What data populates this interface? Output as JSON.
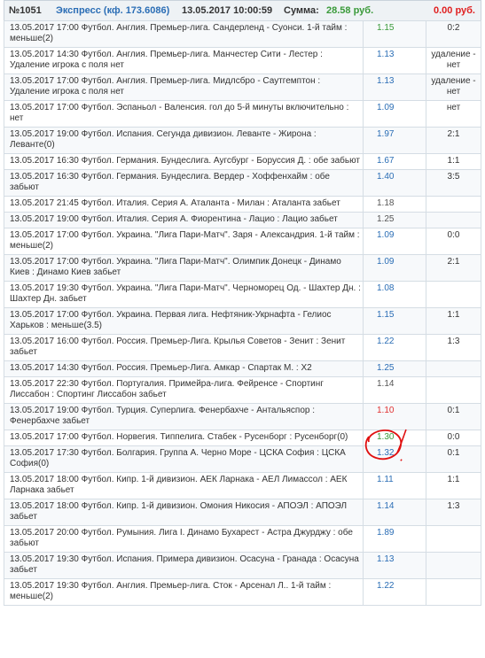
{
  "header": {
    "number": "№1051",
    "express": "Экспресс (кф. 173.6086)",
    "datetime": "13.05.2017 10:00:59",
    "sum_label": "Сумма:",
    "sum_value": "28.58 руб.",
    "win": "0.00 руб."
  },
  "rows": [
    {
      "event": "13.05.2017 17:00 Футбол. Англия. Премьер-лига. Сандерленд - Суонси. 1-й тайм : меньше(2)",
      "coef": "1.15",
      "coef_color": "green",
      "result": "0:2"
    },
    {
      "event": "13.05.2017 14:30 Футбол. Англия. Премьер-лига. Манчестер Сити - Лестер : Удаление игрока с поля нет",
      "coef": "1.13",
      "coef_color": "blue",
      "result": "удаление - нет"
    },
    {
      "event": "13.05.2017 17:00 Футбол. Англия. Премьер-лига. Мидлсбро - Саутгемптон : Удаление игрока с поля нет",
      "coef": "1.13",
      "coef_color": "blue",
      "result": "удаление - нет"
    },
    {
      "event": "13.05.2017 17:00 Футбол. Эспаньол - Валенсия. гол до 5-й минуты включительно : нет",
      "coef": "1.09",
      "coef_color": "blue",
      "result": "нет"
    },
    {
      "event": "13.05.2017 19:00 Футбол. Испания. Сегунда дивизион. Леванте - Жирона : Леванте(0)",
      "coef": "1.97",
      "coef_color": "blue",
      "result": "2:1"
    },
    {
      "event": "13.05.2017 16:30 Футбол. Германия. Бундеслига. Аугсбург - Боруссия Д. : обе забьют",
      "coef": "1.67",
      "coef_color": "blue",
      "result": "1:1"
    },
    {
      "event": "13.05.2017 16:30 Футбол. Германия. Бундеслига. Вердер - Хоффенхайм : обе забьют",
      "coef": "1.40",
      "coef_color": "blue",
      "result": "3:5"
    },
    {
      "event": "13.05.2017 21:45 Футбол. Италия. Серия А. Аталанта - Милан : Аталанта забьет",
      "coef": "1.18",
      "coef_color": "gray",
      "result": ""
    },
    {
      "event": "13.05.2017 19:00 Футбол. Италия. Серия А. Фиорентина - Лацио : Лацио забьет",
      "coef": "1.25",
      "coef_color": "gray",
      "result": ""
    },
    {
      "event": "13.05.2017 17:00 Футбол. Украина. \"Лига Пари-Матч\". Заря - Александрия. 1-й тайм : меньше(2)",
      "coef": "1.09",
      "coef_color": "blue",
      "result": "0:0"
    },
    {
      "event": "13.05.2017 17:00 Футбол. Украина. \"Лига Пари-Матч\". Олимпик Донецк - Динамо Киев : Динамо Киев забьет",
      "coef": "1.09",
      "coef_color": "blue",
      "result": "2:1"
    },
    {
      "event": "13.05.2017 19:30 Футбол. Украина. \"Лига Пари-Матч\". Черноморец Од. - Шахтер Дн. : Шахтер Дн. забьет",
      "coef": "1.08",
      "coef_color": "blue",
      "result": ""
    },
    {
      "event": "13.05.2017 17:00 Футбол. Украина. Первая лига. Нефтяник-Укрнафта - Гелиос Харьков : меньше(3.5)",
      "coef": "1.15",
      "coef_color": "blue",
      "result": "1:1"
    },
    {
      "event": "13.05.2017 16:00 Футбол. Россия. Премьер-Лига. Крылья Советов - Зенит : Зенит забьет",
      "coef": "1.22",
      "coef_color": "blue",
      "result": "1:3"
    },
    {
      "event": "13.05.2017 14:30 Футбол. Россия. Премьер-Лига. Амкар - Спартак М. : X2",
      "coef": "1.25",
      "coef_color": "blue",
      "result": ""
    },
    {
      "event": "13.05.2017 22:30 Футбол. Португалия. Примейра-лига. Фейренсе - Спортинг Лиссабон : Спортинг Лиссабон забьет",
      "coef": "1.14",
      "coef_color": "gray",
      "result": ""
    },
    {
      "event": "13.05.2017 19:00 Футбол. Турция. Суперлига. Фенербахче - Антальяспор : Фенербахче забьет",
      "coef": "1.10",
      "coef_color": "red",
      "result": "0:1"
    },
    {
      "event": "13.05.2017 17:00 Футбол. Норвегия. Типпелига. Стабек - Русенборг : Русенборг(0)",
      "coef": "1.30",
      "coef_color": "green",
      "result": "0:0"
    },
    {
      "event": "13.05.2017 17:30 Футбол. Болгария. Группа А. Черно Море - ЦСКА София : ЦСКА София(0)",
      "coef": "1.32",
      "coef_color": "blue",
      "result": "0:1"
    },
    {
      "event": "13.05.2017 18:00 Футбол. Кипр. 1-й дивизион. АЕК Ларнака - АЕЛ Лимассол : АЕК Ларнака забьет",
      "coef": "1.11",
      "coef_color": "blue",
      "result": "1:1"
    },
    {
      "event": "13.05.2017 18:00 Футбол. Кипр. 1-й дивизион. Омония Никосия - АПОЭЛ : АПОЭЛ забьет",
      "coef": "1.14",
      "coef_color": "blue",
      "result": "1:3"
    },
    {
      "event": "13.05.2017 20:00 Футбол. Румыния. Лига I. Динамо Бухарест - Астра Джурджу : обе забьют",
      "coef": "1.89",
      "coef_color": "blue",
      "result": ""
    },
    {
      "event": "13.05.2017 19:30 Футбол. Испания. Примера дивизион. Осасуна - Гранада : Осасуна забьет",
      "coef": "1.13",
      "coef_color": "blue",
      "result": ""
    },
    {
      "event": "13.05.2017 19:30 Футбол. Англия. Премьер-лига. Сток - Арсенал Л.. 1-й тайм : меньше(2)",
      "coef": "1.22",
      "coef_color": "blue",
      "result": ""
    }
  ],
  "annotation": {
    "color": "#e01010"
  }
}
